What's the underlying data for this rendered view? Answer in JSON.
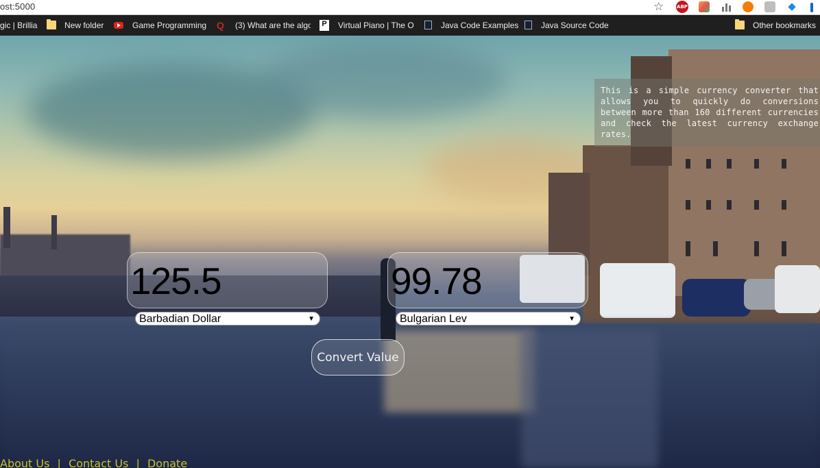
{
  "browser": {
    "url": "ost:5000",
    "bookmarks": [
      {
        "label": "gic | Brillia",
        "icon": "none"
      },
      {
        "label": "New folder",
        "icon": "folder-icon"
      },
      {
        "label": "Game Programming",
        "icon": "youtube-icon"
      },
      {
        "label": "(3) What are the algo",
        "icon": "quora-icon"
      },
      {
        "label": "Virtual Piano | The O",
        "icon": "piano-icon"
      },
      {
        "label": "Java Code Examples",
        "icon": "document-icon"
      },
      {
        "label": "Java Source Code",
        "icon": "document-icon"
      },
      {
        "label": "Other bookmarks",
        "icon": "folder-icon"
      }
    ],
    "extensions": {
      "abp_label": "ABP"
    }
  },
  "converter": {
    "from": {
      "amount": "125.5",
      "currency": "Barbadian Dollar"
    },
    "to": {
      "amount": "99.78",
      "currency": "Bulgarian Lev"
    },
    "convert_label": "Convert Value"
  },
  "info": {
    "text": "This is a simple currency converter that allows you to quickly do conversions between more than 160 different currencies and check the latest currency exchange rates."
  },
  "footer": {
    "about": "About Us",
    "contact": "Contact Us",
    "donate": "Donate",
    "separator": "|"
  },
  "colors": {
    "footer_link": "#c8c02a",
    "bookmark_bar": "#1f1f1f"
  }
}
